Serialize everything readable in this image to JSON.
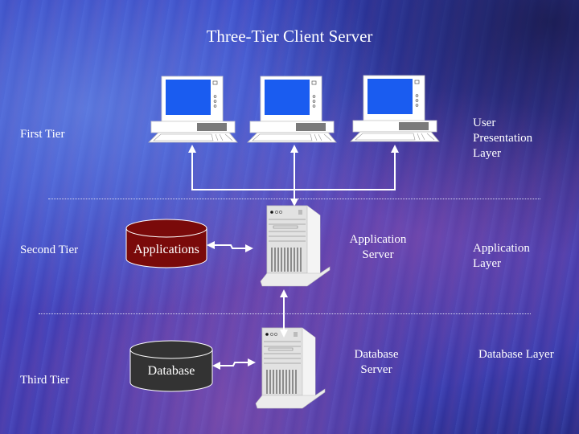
{
  "title": "Three-Tier Client Server",
  "tiers": {
    "first": "First Tier",
    "second": "Second Tier",
    "third": "Third Tier"
  },
  "layers": {
    "presentation": [
      "User",
      "Presentation",
      "Layer"
    ],
    "application": [
      "Application",
      "Layer"
    ],
    "database": "Database Layer"
  },
  "servers": {
    "application": [
      "Application",
      "Server"
    ],
    "database": [
      "Database",
      "Server"
    ]
  },
  "stores": {
    "applications": "Applications",
    "database": "Database"
  },
  "colors": {
    "screen": "#1a5cf0",
    "applications_cylinder": "#7a0a0a",
    "database_cylinder": "#333333"
  }
}
